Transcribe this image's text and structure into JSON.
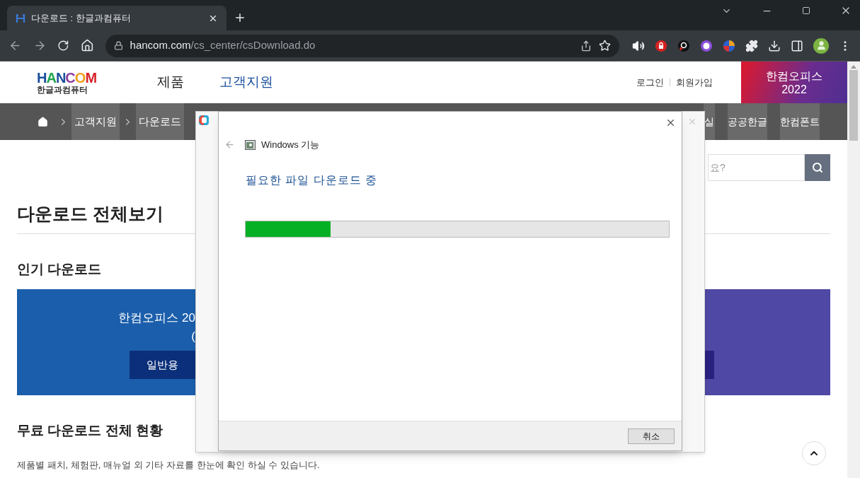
{
  "browser": {
    "tab": {
      "title": "다운로드 : 한글과컴퓨터"
    },
    "address": {
      "host": "hancom.com",
      "path": "/cs_center/csDownload.do"
    }
  },
  "header": {
    "logo": "HANCOM",
    "logo_subtitle": "한글과컴퓨터",
    "nav": [
      {
        "label": "제품",
        "selected": false
      },
      {
        "label": "고객지원",
        "selected": true
      }
    ],
    "account_links": [
      "로그인",
      "회원가입"
    ],
    "promo": {
      "line1": "한컴오피스",
      "line2": "2022"
    }
  },
  "breadcrumb": [
    "고객지원",
    "다운로드"
  ],
  "quick_links": [
    "실",
    "공공한글",
    "한컴폰트"
  ],
  "search": {
    "placeholder": "요?"
  },
  "page_title": "다운로드 전체보기",
  "popular": {
    "heading": "인기 다운로드",
    "banner_title": "한컴오피스 20",
    "banner_subtitle": "(",
    "button": "일반용"
  },
  "status_section": {
    "heading": "무료 다운로드 전체 현황",
    "description": "제품별 패치, 체험판, 매뉴얼 외 기타 자료를 한눈에 확인 하실 수 있습니다."
  },
  "dialog": {
    "title": "Windows 기능",
    "message": "필요한 파일 다운로드 중",
    "progress": {
      "level": 0.2
    },
    "buttons": [
      "취소"
    ]
  }
}
